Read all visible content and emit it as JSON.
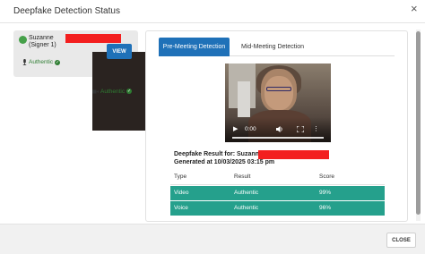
{
  "modal": {
    "title": "Deepfake Detection Status",
    "close_icon": "×",
    "close_button_label": "CLOSE"
  },
  "signer": {
    "name": "Suzanne",
    "role": "(Signer 1)",
    "video_status": "Authentic",
    "voice_status": "Authentic",
    "view_button_label": "VIEW",
    "status_color": "#45a049",
    "authentic_color": "#2e7d32"
  },
  "tabs": [
    {
      "label": "Pre-Meeting Detection",
      "active": true
    },
    {
      "label": "Mid-Meeting Detection",
      "active": false
    }
  ],
  "video_player": {
    "time": "0:00"
  },
  "result": {
    "title": "Deepfake Result for: Suzanne",
    "generated": "Generated at 10/03/2025 03:15 pm",
    "columns": [
      "Type",
      "Result",
      "Score"
    ],
    "rows": [
      {
        "type": "Video",
        "result": "Authentic",
        "score": "99%"
      },
      {
        "type": "Voice",
        "result": "Authentic",
        "score": "96%"
      }
    ],
    "row_color": "#25a08c"
  },
  "accent_color": "#1f71b8",
  "redaction_color": "#f31f1f"
}
